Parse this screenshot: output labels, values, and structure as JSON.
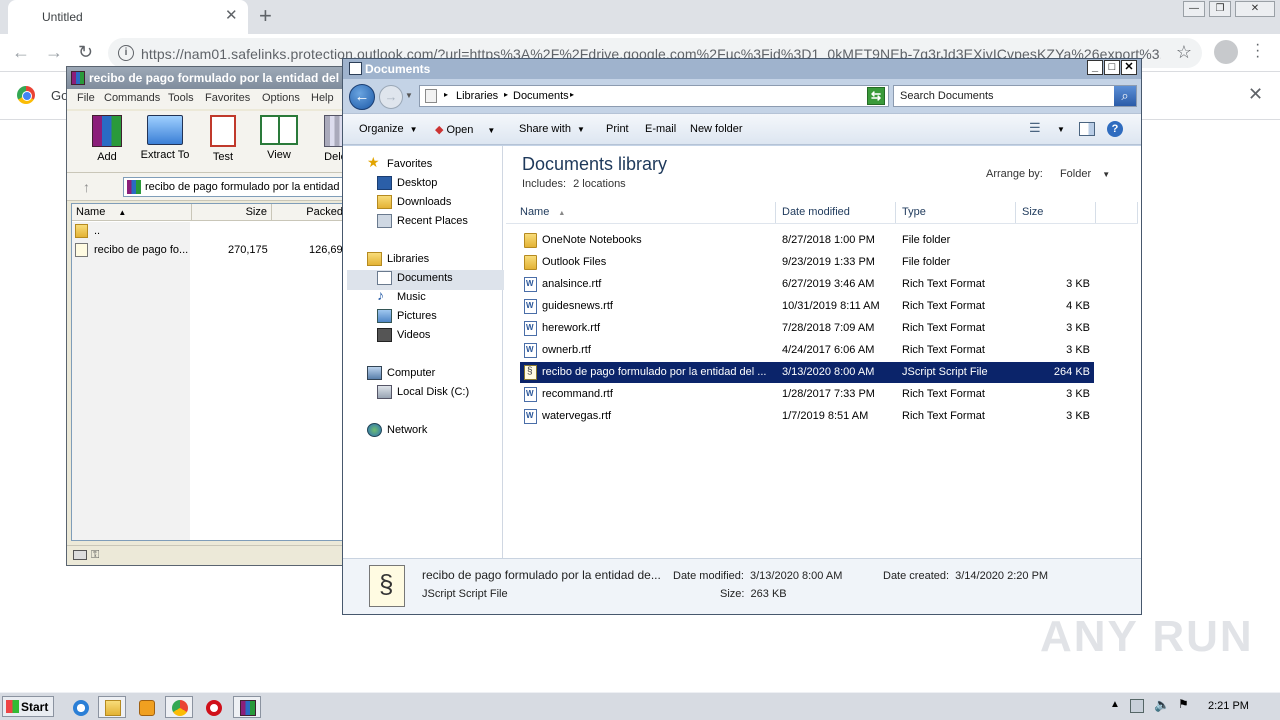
{
  "chrome": {
    "tab_title": "Untitled",
    "tab_close": "✕",
    "new_tab": "+",
    "url": "https://nam01.safelinks.protection.outlook.com/?url=https%3A%2F%2Fdrive.google.com%2Fuc%3Fid%3D1_0kMET9NEb-7q3rJd3EXivICvpesKZYa%26export%3...",
    "infobar_text": "Go",
    "infobar_close": "✕",
    "back": "←",
    "forward": "→",
    "reload": "↻",
    "star": "☆"
  },
  "winrar": {
    "title": "recibo de pago formulado por la entidad del ...",
    "menu": [
      "File",
      "Commands",
      "Tools",
      "Favorites",
      "Options",
      "Help"
    ],
    "toolbar": [
      {
        "label": "Add",
        "icon": "add-archive-icon"
      },
      {
        "label": "Extract To",
        "icon": "extract-folder-icon"
      },
      {
        "label": "Test",
        "icon": "test-clipboard-icon"
      },
      {
        "label": "View",
        "icon": "view-book-icon"
      },
      {
        "label": "Delet",
        "icon": "delete-trash-icon"
      }
    ],
    "address": "recibo de pago formulado por la entidad del",
    "columns": [
      "Name",
      "Size",
      "Packed"
    ],
    "sort_arrow": "▲",
    "rows": [
      {
        "name": "..",
        "size": "",
        "packed": ""
      },
      {
        "name": "recibo de pago fo...",
        "size": "270,175",
        "packed": "126,692"
      }
    ]
  },
  "explorer": {
    "title": "Documents",
    "breadcrumb": [
      "Libraries",
      "Documents"
    ],
    "search_placeholder": "Search Documents",
    "commands": {
      "organize": "Organize",
      "open": "Open",
      "share_with": "Share with",
      "print": "Print",
      "email": "E-mail",
      "new_folder": "New folder"
    },
    "nav": {
      "favorites": "Favorites",
      "desktop": "Desktop",
      "downloads": "Downloads",
      "recent_places": "Recent Places",
      "libraries": "Libraries",
      "documents": "Documents",
      "music": "Music",
      "pictures": "Pictures",
      "videos": "Videos",
      "computer": "Computer",
      "local_disk": "Local Disk (C:)",
      "network": "Network"
    },
    "library_title": "Documents library",
    "includes_label": "Includes:",
    "includes_value": "2 locations",
    "arrange_label": "Arrange by:",
    "arrange_value": "Folder",
    "columns": {
      "name": "Name",
      "date": "Date modified",
      "type": "Type",
      "size": "Size"
    },
    "files": [
      {
        "name": "OneNote Notebooks",
        "date": "8/27/2018 1:00 PM",
        "type": "File folder",
        "size": "",
        "icon": "folder"
      },
      {
        "name": "Outlook Files",
        "date": "9/23/2019 1:33 PM",
        "type": "File folder",
        "size": "",
        "icon": "folder"
      },
      {
        "name": "analsince.rtf",
        "date": "6/27/2019 3:46 AM",
        "type": "Rich Text Format",
        "size": "3 KB",
        "icon": "rtf"
      },
      {
        "name": "guidesnews.rtf",
        "date": "10/31/2019 8:11 AM",
        "type": "Rich Text Format",
        "size": "4 KB",
        "icon": "rtf"
      },
      {
        "name": "herework.rtf",
        "date": "7/28/2018 7:09 AM",
        "type": "Rich Text Format",
        "size": "3 KB",
        "icon": "rtf"
      },
      {
        "name": "ownerb.rtf",
        "date": "4/24/2017 6:06 AM",
        "type": "Rich Text Format",
        "size": "3 KB",
        "icon": "rtf"
      },
      {
        "name": "recibo de pago formulado por la entidad del ...",
        "date": "3/13/2020 8:00 AM",
        "type": "JScript Script File",
        "size": "264 KB",
        "icon": "js",
        "selected": true
      },
      {
        "name": "recommand.rtf",
        "date": "1/28/2017 7:33 PM",
        "type": "Rich Text Format",
        "size": "3 KB",
        "icon": "rtf"
      },
      {
        "name": "watervegas.rtf",
        "date": "1/7/2019 8:51 AM",
        "type": "Rich Text Format",
        "size": "3 KB",
        "icon": "rtf"
      }
    ],
    "details": {
      "name": "recibo de pago formulado por la entidad de...",
      "type": "JScript Script File",
      "date_modified_label": "Date modified:",
      "date_modified": "3/13/2020 8:00 AM",
      "date_created_label": "Date created:",
      "date_created": "3/14/2020 2:20 PM",
      "size_label": "Size:",
      "size": "263 KB"
    }
  },
  "watermark": "ANY RUN",
  "taskbar": {
    "start": "Start",
    "time": "2:21 PM",
    "apps": [
      "internet-explorer-icon",
      "file-explorer-icon",
      "media-player-icon",
      "chrome-icon",
      "opera-icon",
      "winrar-icon"
    ]
  }
}
